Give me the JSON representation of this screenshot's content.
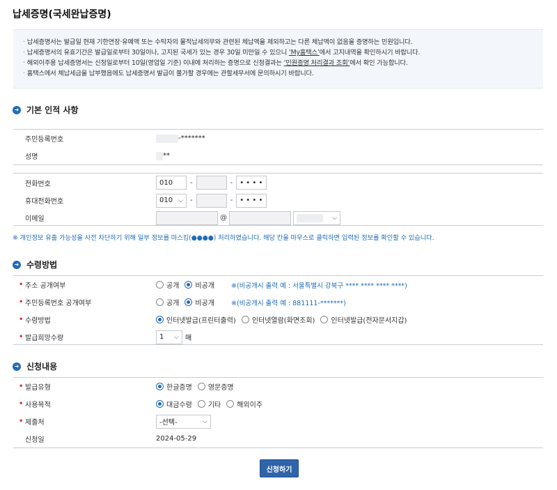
{
  "page_title": "납세증명(국세완납증명)",
  "notices": [
    {
      "text": "납세증명서는 발급일 현재 기한연장·유예액 또는 수탁자의 물적납세의무와 관련된 체납액을 제외하고는 다른 체납액이 없음을 증명하는 민원입니다."
    },
    {
      "text_before": "납세증명서의 유효기간은 발급일로부터 30일이나, 고지된 국세가 있는 경우 30일 미만일 수 있으니 ",
      "link": "‘My홈택스’",
      "text_after": "에서 고지내역을 확인하시기 바랍니다."
    },
    {
      "text_before": "해외이주용 납세증명서는 신청일로부터 10일(영업일 기준) 이내에 처리하는 증명으로 신청결과는 ",
      "link": "‘민원증명 처리결과 조회’",
      "text_after": "에서 확인 가능합니다."
    },
    {
      "text": "홈택스에서 체납세금을 납부했음에도 납세증명서 발급이 불가할 경우에는 관할세무서에 문의하시기 바랍니다."
    }
  ],
  "basic": {
    "title": "기본 인적 사항",
    "rrn_label": "주민등록번호",
    "rrn_value": "-*******",
    "name_label": "성명",
    "name_value": "**",
    "phone_label": "전화번호",
    "phone_first": "010",
    "phone_dash": "-",
    "phone_last": "• • • •",
    "mobile_label": "휴대전화번호",
    "mobile_first": "010",
    "mobile_last": "• • • •",
    "email_label": "이메일",
    "email_at": "@",
    "mask_note": "※ 개인정보 유출 가능성을 사전 차단하기 위해 일부 정보를 마스킹(●●●●) 처리하였습니다. 해당 칸을 마우스로 클릭하면 입력된 정보를 확인할 수 있습니다."
  },
  "receive": {
    "title": "수령방법",
    "address_label": "주소 공개여부",
    "public": "공개",
    "private": "비공개",
    "address_hint": "※(비공개시 출력 예 : 서울특별시 강북구 **** **** **** ****)",
    "rrn_public_label": "주민등록번호 공개여부",
    "rrn_hint": "※(비공개시 출력 예 : 881111-*******)",
    "method_label": "수령방법",
    "method_options": [
      "인터넷발급(프린터출력)",
      "인터넷열람(화면조회)",
      "인터넷발급(전자문서지갑)"
    ],
    "count_label": "발급희망수량",
    "count_value": "1",
    "count_unit": "매"
  },
  "apply": {
    "title": "신청내용",
    "type_label": "발급유형",
    "type_options": [
      "한글증명",
      "영문증명"
    ],
    "purpose_label": "사용목적",
    "purpose_options": [
      "대금수령",
      "기타",
      "해외이주"
    ],
    "submit_to_label": "제출처",
    "submit_to_value": "-선택-",
    "date_label": "신청일",
    "date_value": "2024-05-29"
  },
  "submit_button": "신청하기",
  "colors": {
    "accent": "#1f6bb8",
    "button": "#2f64a8",
    "required": "#dd3333",
    "notice_bg": "#f3f6fa"
  }
}
